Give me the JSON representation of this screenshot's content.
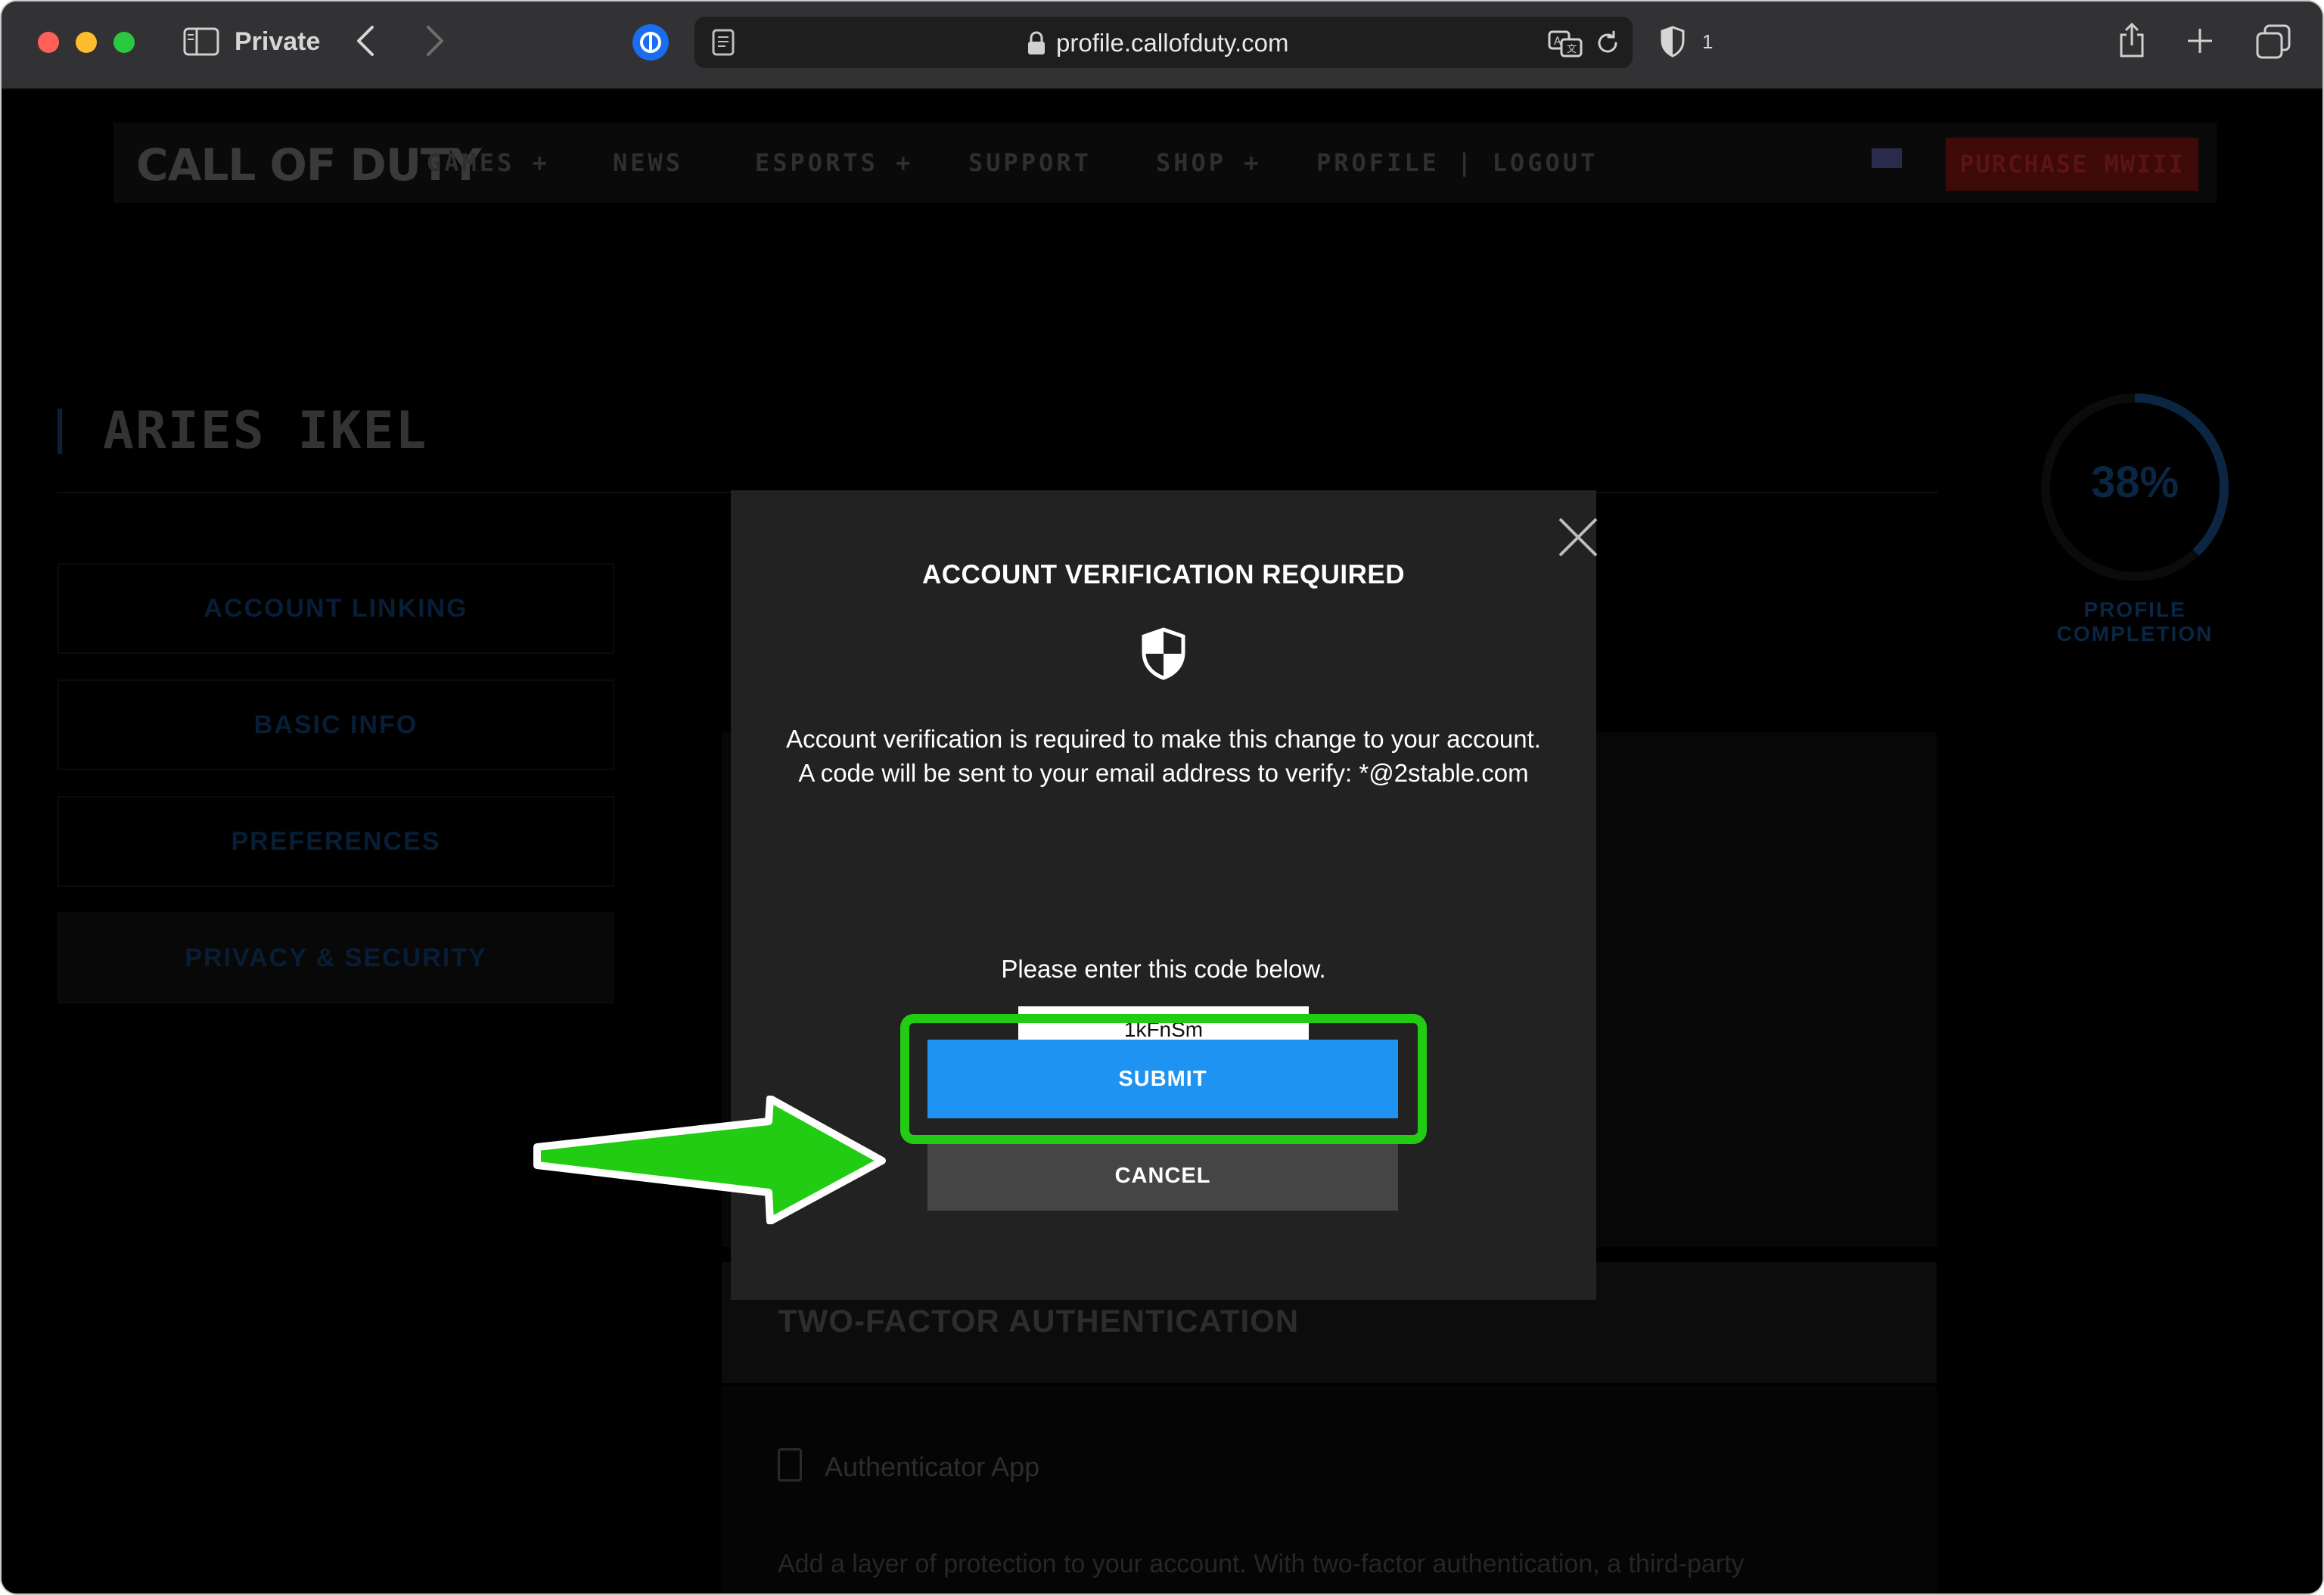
{
  "browser": {
    "private_label": "Private",
    "url": "profile.callofduty.com",
    "shield_count": "1"
  },
  "site_nav": {
    "logo": "CALL OF DUTY",
    "items": [
      {
        "label": "GAMES  +"
      },
      {
        "label": "NEWS"
      },
      {
        "label": "ESPORTS  +"
      },
      {
        "label": "SUPPORT"
      },
      {
        "label": "SHOP  +"
      },
      {
        "label": "PROFILE | LOGOUT"
      }
    ],
    "purchase_label": "PURCHASE MWIII"
  },
  "profile": {
    "name": "ARIES IKEL",
    "tabs": [
      {
        "label": "ACCOUNT LINKING"
      },
      {
        "label": "BASIC INFO"
      },
      {
        "label": "PREFERENCES"
      },
      {
        "label": "PRIVACY & SECURITY"
      }
    ],
    "completion_percent": "38%",
    "completion_value": 0.38,
    "completion_label": "PROFILE COMPLETION"
  },
  "security_section": {
    "title": "TWO-FACTOR AUTHENTICATION",
    "authenticator_label": "Authenticator App",
    "description": "Add a layer of protection to your account. With two-factor authentication, a third-party"
  },
  "modal": {
    "title": "ACCOUNT VERIFICATION REQUIRED",
    "body": "Account verification is required to make this change to your account. A code will be sent to your email address to verify: *@2stable.com",
    "prompt": "Please enter this code below.",
    "code_value": "1kFnSm",
    "submit_label": "SUBMIT",
    "cancel_label": "CANCEL"
  },
  "colors": {
    "submit": "#1f93f2",
    "highlight": "#22cc12",
    "modal_bg": "#222222"
  }
}
